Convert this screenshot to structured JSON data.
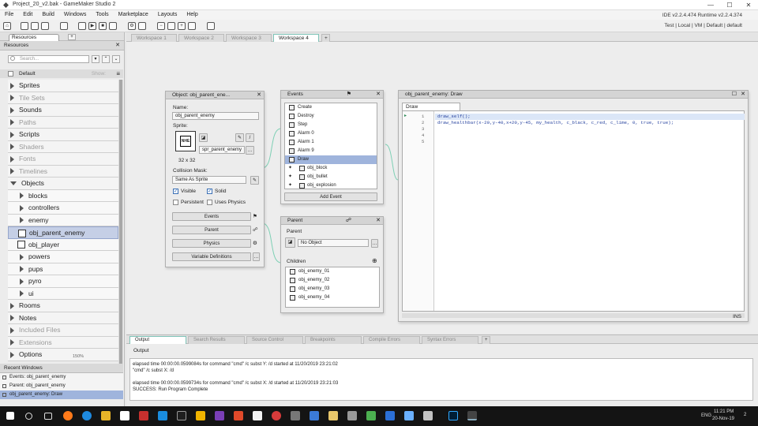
{
  "window": {
    "title": "Project_20_v2.bak - GameMaker Studio 2"
  },
  "menu": [
    "File",
    "Edit",
    "Build",
    "Windows",
    "Tools",
    "Marketplace",
    "Layouts",
    "Help"
  ],
  "toolbar_right": "IDE v2.2.4.474   Runtime v2.2.4.374",
  "target_bar": "Test | Local | VM | Default | default",
  "resources": {
    "tab_label": "Resources",
    "header": "Resources",
    "search_placeholder": "Search...",
    "default_label": "Default",
    "show_label": "Show:",
    "tree": [
      {
        "label": "Sprites",
        "state": "collapsed",
        "dim": false
      },
      {
        "label": "Tile Sets",
        "state": "collapsed",
        "dim": true
      },
      {
        "label": "Sounds",
        "state": "collapsed",
        "dim": false
      },
      {
        "label": "Paths",
        "state": "collapsed",
        "dim": true
      },
      {
        "label": "Scripts",
        "state": "collapsed",
        "dim": false
      },
      {
        "label": "Shaders",
        "state": "collapsed",
        "dim": true
      },
      {
        "label": "Fonts",
        "state": "collapsed",
        "dim": true
      },
      {
        "label": "Timelines",
        "state": "collapsed",
        "dim": true
      },
      {
        "label": "Objects",
        "state": "expanded",
        "dim": false
      },
      {
        "label": "blocks",
        "state": "child",
        "dim": false
      },
      {
        "label": "controllers",
        "state": "child",
        "dim": false
      },
      {
        "label": "enemy",
        "state": "child",
        "dim": false
      },
      {
        "label": "obj_parent_enemy",
        "state": "selected",
        "dim": false
      },
      {
        "label": "obj_player",
        "state": "object",
        "dim": false
      },
      {
        "label": "powers",
        "state": "child",
        "dim": false
      },
      {
        "label": "pups",
        "state": "child",
        "dim": false
      },
      {
        "label": "pyro",
        "state": "child",
        "dim": false
      },
      {
        "label": "ui",
        "state": "child",
        "dim": false
      },
      {
        "label": "Rooms",
        "state": "collapsed",
        "dim": false
      },
      {
        "label": "Notes",
        "state": "collapsed",
        "dim": false
      },
      {
        "label": "Included Files",
        "state": "collapsed",
        "dim": true
      },
      {
        "label": "Extensions",
        "state": "collapsed",
        "dim": true
      },
      {
        "label": "Options",
        "state": "collapsed",
        "dim": false
      }
    ],
    "zoom": "150%"
  },
  "recent": {
    "header": "Recent Windows",
    "items": [
      {
        "label": "Events: obj_parent_enemy",
        "selected": false
      },
      {
        "label": "Parent: obj_parent_enemy",
        "selected": false
      },
      {
        "label": "obj_parent_enemy: Draw",
        "selected": true
      }
    ]
  },
  "workspaces": [
    "Workspace 1",
    "Workspace 2",
    "Workspace 3",
    "Workspace 4"
  ],
  "object_window": {
    "title": "Object: obj_parent_ene...",
    "name_label": "Name:",
    "name_value": "obj_parent_enemy",
    "sprite_label": "Sprite:",
    "sprite_name": "spr_parent_enemy",
    "sprite_size": "32 x 32",
    "sprite_thumb_text": "NHE",
    "collision_label": "Collision Mask:",
    "collision_value": "Same As Sprite",
    "visible_label": "Visible",
    "solid_label": "Solid",
    "persistent_label": "Persistent",
    "physics_label": "Uses Physics",
    "visible": true,
    "solid": true,
    "persistent": false,
    "uses_physics": false,
    "btn_events": "Events",
    "btn_parent": "Parent",
    "btn_physics": "Physics",
    "btn_vardefs": "Variable Definitions"
  },
  "events_window": {
    "title": "Events",
    "events": [
      {
        "label": "Create",
        "sel": false,
        "sub": false
      },
      {
        "label": "Destroy",
        "sel": false,
        "sub": false
      },
      {
        "label": "Step",
        "sel": false,
        "sub": false
      },
      {
        "label": "Alarm 0",
        "sel": false,
        "sub": false
      },
      {
        "label": "Alarm 1",
        "sel": false,
        "sub": false
      },
      {
        "label": "Alarm 9",
        "sel": false,
        "sub": false
      },
      {
        "label": "Draw",
        "sel": true,
        "sub": false
      },
      {
        "label": "obj_block",
        "sel": false,
        "sub": true
      },
      {
        "label": "obj_bullet",
        "sel": false,
        "sub": true
      },
      {
        "label": "obj_explosion",
        "sel": false,
        "sub": true
      }
    ],
    "add_event": "Add Event"
  },
  "parent_window": {
    "title": "Parent",
    "parent_label": "Parent",
    "parent_value": "No Object",
    "children_label": "Children",
    "children": [
      "obj_enemy_01",
      "obj_enemy_02",
      "obj_enemy_03",
      "obj_enemy_04"
    ]
  },
  "code_window": {
    "title": "obj_parent_enemy: Draw",
    "tab": "Draw",
    "line_numbers": [
      "1",
      "2",
      "3",
      "4",
      "5"
    ],
    "lines": [
      "draw_self();",
      "draw_healthbar(x-20,y-40,x+20,y-45, my_health, c_black, c_red, c_lime, 0, true, true);",
      "",
      "",
      ""
    ],
    "status": "INS"
  },
  "output": {
    "tabs": [
      "Output",
      "Search Results",
      "Source Control",
      "Breakpoints",
      "Compile Errors",
      "Syntax Errors"
    ],
    "header": "Output",
    "lines": [
      "elapsed time 00:00:00.0599084s for command \"cmd\" /c subst Y: /d started at 11/20/2019 23:21:02",
      "\"cmd\" /c subst X: /d",
      "",
      "elapsed time 00:00:00.0599734s for command \"cmd\" /c subst X: /d started at 11/20/2019 23:21:03",
      "SUCCESS: Run Program Complete"
    ]
  },
  "taskbar": {
    "lang": "ENG",
    "time": "11:21 PM",
    "date": "20-Nov-19",
    "notif": "2"
  }
}
